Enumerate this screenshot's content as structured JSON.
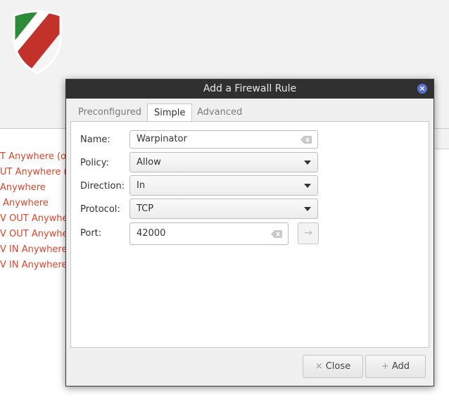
{
  "background": {
    "rule_rows": [
      "T Anywhere (ou",
      "UT Anywhere (o",
      "Anywhere",
      " Anywhere",
      "V OUT Anywher",
      "V OUT Anywhe",
      "V IN Anywhere (",
      "V IN Anywhere"
    ]
  },
  "dialog": {
    "title": "Add a Firewall Rule",
    "tabs": [
      "Preconfigured",
      "Simple",
      "Advanced"
    ],
    "active_tab": "Simple",
    "form": {
      "name_label": "Name:",
      "name_value": "Warpinator",
      "policy_label": "Policy:",
      "policy_value": "Allow",
      "direction_label": "Direction:",
      "direction_value": "In",
      "protocol_label": "Protocol:",
      "protocol_value": "TCP",
      "port_label": "Port:",
      "port_value": "42000"
    },
    "buttons": {
      "close_label": "Close",
      "add_label": "Add"
    }
  },
  "colors": {
    "titlebar": "#303030",
    "rule_text": "#d9452a",
    "close_badge": "#5b6fd6"
  },
  "icons": [
    "shield-logo-icon",
    "close-window-icon",
    "clear-text-icon",
    "dropdown-arrow-icon",
    "arrow-right-icon",
    "close-x-icon",
    "plus-icon"
  ]
}
